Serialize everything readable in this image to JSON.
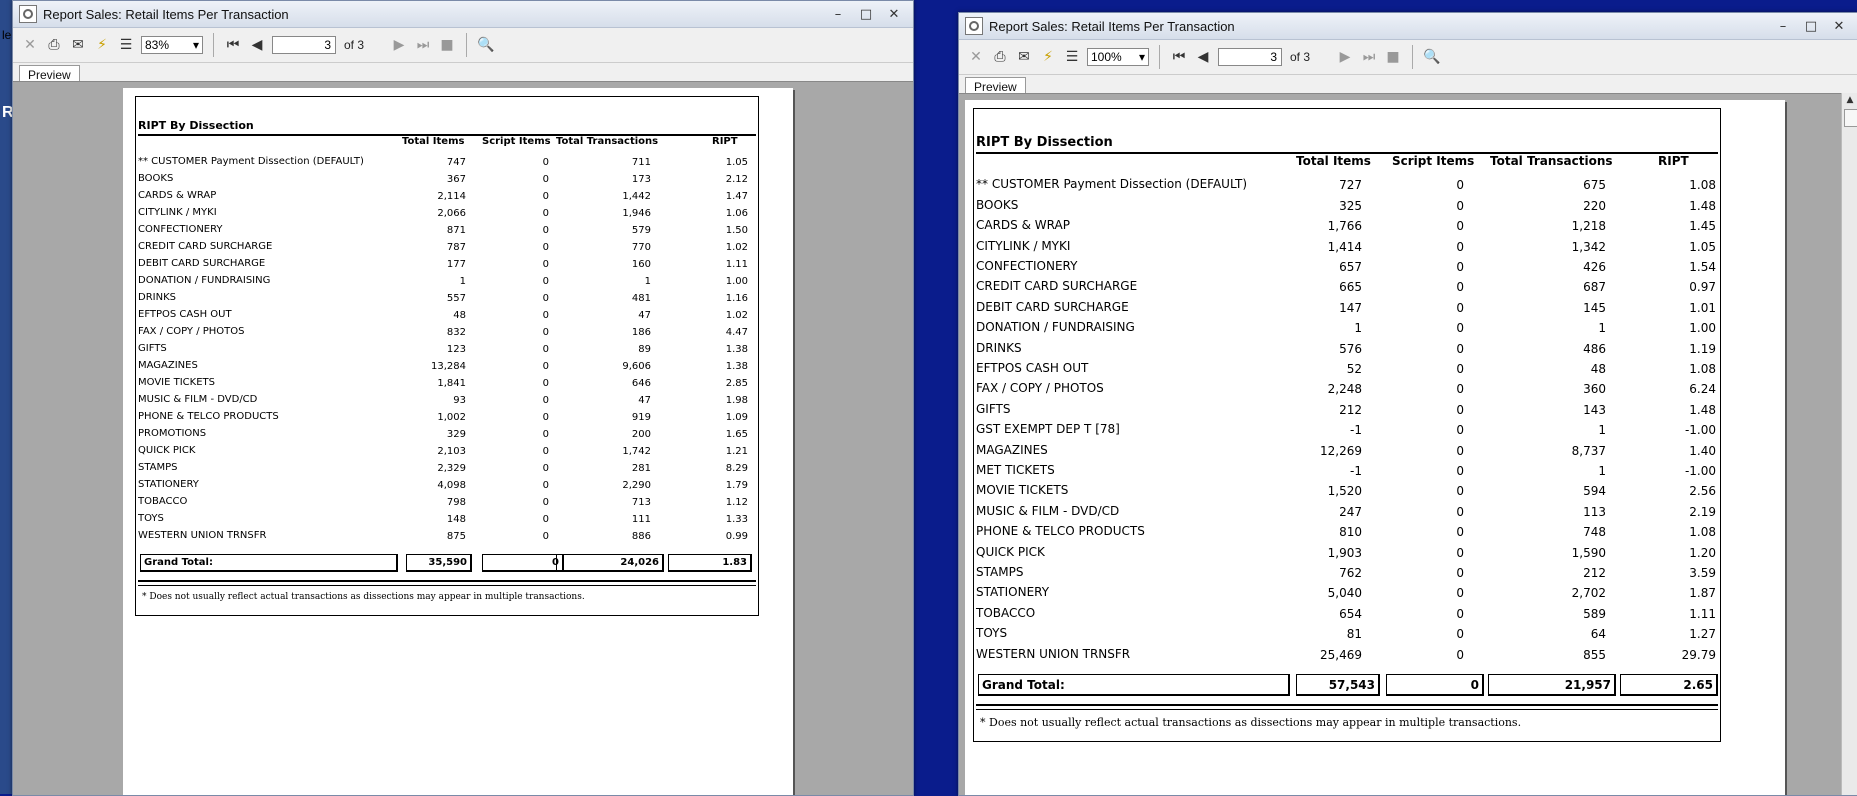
{
  "left_window": {
    "title": "Report Sales: Retail Items Per Transaction",
    "zoom": "83%",
    "page_current": "3",
    "page_total_label": "of 3",
    "tab_label": "Preview",
    "report": {
      "title": "RIPT By Dissection",
      "columns": [
        "Total Items",
        "Script Items",
        "Total Transactions",
        "RIPT"
      ],
      "rows": [
        {
          "name": "** CUSTOMER Payment Dissection (DEFAULT)",
          "total_items": "747",
          "script_items": "0",
          "total_transactions": "711",
          "ript": "1.05"
        },
        {
          "name": "BOOKS",
          "total_items": "367",
          "script_items": "0",
          "total_transactions": "173",
          "ript": "2.12"
        },
        {
          "name": "CARDS & WRAP",
          "total_items": "2,114",
          "script_items": "0",
          "total_transactions": "1,442",
          "ript": "1.47"
        },
        {
          "name": "CITYLINK / MYKI",
          "total_items": "2,066",
          "script_items": "0",
          "total_transactions": "1,946",
          "ript": "1.06"
        },
        {
          "name": "CONFECTIONERY",
          "total_items": "871",
          "script_items": "0",
          "total_transactions": "579",
          "ript": "1.50"
        },
        {
          "name": "CREDIT CARD SURCHARGE",
          "total_items": "787",
          "script_items": "0",
          "total_transactions": "770",
          "ript": "1.02"
        },
        {
          "name": "DEBIT CARD SURCHARGE",
          "total_items": "177",
          "script_items": "0",
          "total_transactions": "160",
          "ript": "1.11"
        },
        {
          "name": "DONATION / FUNDRAISING",
          "total_items": "1",
          "script_items": "0",
          "total_transactions": "1",
          "ript": "1.00"
        },
        {
          "name": "DRINKS",
          "total_items": "557",
          "script_items": "0",
          "total_transactions": "481",
          "ript": "1.16"
        },
        {
          "name": "EFTPOS CASH OUT",
          "total_items": "48",
          "script_items": "0",
          "total_transactions": "47",
          "ript": "1.02"
        },
        {
          "name": "FAX / COPY / PHOTOS",
          "total_items": "832",
          "script_items": "0",
          "total_transactions": "186",
          "ript": "4.47"
        },
        {
          "name": "GIFTS",
          "total_items": "123",
          "script_items": "0",
          "total_transactions": "89",
          "ript": "1.38"
        },
        {
          "name": "MAGAZINES",
          "total_items": "13,284",
          "script_items": "0",
          "total_transactions": "9,606",
          "ript": "1.38"
        },
        {
          "name": "MOVIE TICKETS",
          "total_items": "1,841",
          "script_items": "0",
          "total_transactions": "646",
          "ript": "2.85"
        },
        {
          "name": "MUSIC & FILM - DVD/CD",
          "total_items": "93",
          "script_items": "0",
          "total_transactions": "47",
          "ript": "1.98"
        },
        {
          "name": "PHONE & TELCO PRODUCTS",
          "total_items": "1,002",
          "script_items": "0",
          "total_transactions": "919",
          "ript": "1.09"
        },
        {
          "name": "PROMOTIONS",
          "total_items": "329",
          "script_items": "0",
          "total_transactions": "200",
          "ript": "1.65"
        },
        {
          "name": "QUICK PICK",
          "total_items": "2,103",
          "script_items": "0",
          "total_transactions": "1,742",
          "ript": "1.21"
        },
        {
          "name": "STAMPS",
          "total_items": "2,329",
          "script_items": "0",
          "total_transactions": "281",
          "ript": "8.29"
        },
        {
          "name": "STATIONERY",
          "total_items": "4,098",
          "script_items": "0",
          "total_transactions": "2,290",
          "ript": "1.79"
        },
        {
          "name": "TOBACCO",
          "total_items": "798",
          "script_items": "0",
          "total_transactions": "713",
          "ript": "1.12"
        },
        {
          "name": "TOYS",
          "total_items": "148",
          "script_items": "0",
          "total_transactions": "111",
          "ript": "1.33"
        },
        {
          "name": "WESTERN UNION TRNSFR",
          "total_items": "875",
          "script_items": "0",
          "total_transactions": "886",
          "ript": "0.99"
        }
      ],
      "grand_total": {
        "label": "Grand Total:",
        "total_items": "35,590",
        "script_items": "0",
        "total_transactions": "24,026",
        "ript": "1.83"
      },
      "footnote": "* Does not usually reflect actual transactions as dissections may appear in multiple transactions."
    }
  },
  "right_window": {
    "title": "Report Sales: Retail Items Per Transaction",
    "zoom": "100%",
    "page_current": "3",
    "page_total_label": "of 3",
    "tab_label": "Preview",
    "report": {
      "title": "RIPT By Dissection",
      "columns": [
        "Total Items",
        "Script Items",
        "Total Transactions",
        "RIPT"
      ],
      "rows": [
        {
          "name": "** CUSTOMER Payment Dissection (DEFAULT)",
          "total_items": "727",
          "script_items": "0",
          "total_transactions": "675",
          "ript": "1.08"
        },
        {
          "name": "BOOKS",
          "total_items": "325",
          "script_items": "0",
          "total_transactions": "220",
          "ript": "1.48"
        },
        {
          "name": "CARDS & WRAP",
          "total_items": "1,766",
          "script_items": "0",
          "total_transactions": "1,218",
          "ript": "1.45"
        },
        {
          "name": "CITYLINK / MYKI",
          "total_items": "1,414",
          "script_items": "0",
          "total_transactions": "1,342",
          "ript": "1.05"
        },
        {
          "name": "CONFECTIONERY",
          "total_items": "657",
          "script_items": "0",
          "total_transactions": "426",
          "ript": "1.54"
        },
        {
          "name": "CREDIT CARD SURCHARGE",
          "total_items": "665",
          "script_items": "0",
          "total_transactions": "687",
          "ript": "0.97"
        },
        {
          "name": "DEBIT CARD SURCHARGE",
          "total_items": "147",
          "script_items": "0",
          "total_transactions": "145",
          "ript": "1.01"
        },
        {
          "name": "DONATION / FUNDRAISING",
          "total_items": "1",
          "script_items": "0",
          "total_transactions": "1",
          "ript": "1.00"
        },
        {
          "name": "DRINKS",
          "total_items": "576",
          "script_items": "0",
          "total_transactions": "486",
          "ript": "1.19"
        },
        {
          "name": "EFTPOS CASH OUT",
          "total_items": "52",
          "script_items": "0",
          "total_transactions": "48",
          "ript": "1.08"
        },
        {
          "name": "FAX / COPY / PHOTOS",
          "total_items": "2,248",
          "script_items": "0",
          "total_transactions": "360",
          "ript": "6.24"
        },
        {
          "name": "GIFTS",
          "total_items": "212",
          "script_items": "0",
          "total_transactions": "143",
          "ript": "1.48"
        },
        {
          "name": "GST EXEMPT DEP T [78]",
          "total_items": "-1",
          "script_items": "0",
          "total_transactions": "1",
          "ript": "-1.00"
        },
        {
          "name": "MAGAZINES",
          "total_items": "12,269",
          "script_items": "0",
          "total_transactions": "8,737",
          "ript": "1.40"
        },
        {
          "name": "MET TICKETS",
          "total_items": "-1",
          "script_items": "0",
          "total_transactions": "1",
          "ript": "-1.00"
        },
        {
          "name": "MOVIE TICKETS",
          "total_items": "1,520",
          "script_items": "0",
          "total_transactions": "594",
          "ript": "2.56"
        },
        {
          "name": "MUSIC & FILM - DVD/CD",
          "total_items": "247",
          "script_items": "0",
          "total_transactions": "113",
          "ript": "2.19"
        },
        {
          "name": "PHONE & TELCO PRODUCTS",
          "total_items": "810",
          "script_items": "0",
          "total_transactions": "748",
          "ript": "1.08"
        },
        {
          "name": "QUICK PICK",
          "total_items": "1,903",
          "script_items": "0",
          "total_transactions": "1,590",
          "ript": "1.20"
        },
        {
          "name": "STAMPS",
          "total_items": "762",
          "script_items": "0",
          "total_transactions": "212",
          "ript": "3.59"
        },
        {
          "name": "STATIONERY",
          "total_items": "5,040",
          "script_items": "0",
          "total_transactions": "2,702",
          "ript": "1.87"
        },
        {
          "name": "TOBACCO",
          "total_items": "654",
          "script_items": "0",
          "total_transactions": "589",
          "ript": "1.11"
        },
        {
          "name": "TOYS",
          "total_items": "81",
          "script_items": "0",
          "total_transactions": "64",
          "ript": "1.27"
        },
        {
          "name": "WESTERN UNION TRNSFR",
          "total_items": "25,469",
          "script_items": "0",
          "total_transactions": "855",
          "ript": "29.79"
        }
      ],
      "grand_total": {
        "label": "Grand Total:",
        "total_items": "57,543",
        "script_items": "0",
        "total_transactions": "21,957",
        "ript": "2.65"
      },
      "footnote": "* Does not usually reflect actual transactions as dissections may appear in multiple transactions."
    }
  },
  "background_fragments": [
    "le",
    "R"
  ]
}
